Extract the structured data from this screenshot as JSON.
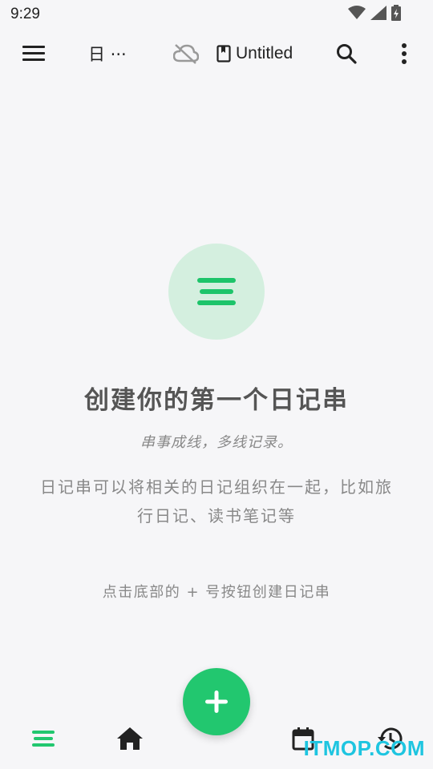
{
  "status_bar": {
    "time": "9:29"
  },
  "toolbar": {
    "journal_title": "日 ···",
    "notebook_name": "Untitled"
  },
  "empty_state": {
    "title": "创建你的第一个日记串",
    "subtitle": "串事成线，多线记录。",
    "description": "日记串可以将相关的日记组织在一起，比如旅行日记、读书笔记等",
    "hint": "点击底部的 + 号按钮创建日记串"
  },
  "bottom_nav": {
    "items": [
      {
        "name": "threads",
        "icon": "threads-icon",
        "active": true
      },
      {
        "name": "home",
        "icon": "home-icon",
        "active": false
      },
      {
        "name": "calendar",
        "icon": "calendar-icon",
        "active": false
      },
      {
        "name": "history",
        "icon": "history-icon",
        "active": false
      }
    ]
  },
  "colors": {
    "accent": "#22c76f",
    "accent_light": "#d4efdf",
    "background": "#f6f6f8"
  },
  "watermark": "ITMOP.COM"
}
